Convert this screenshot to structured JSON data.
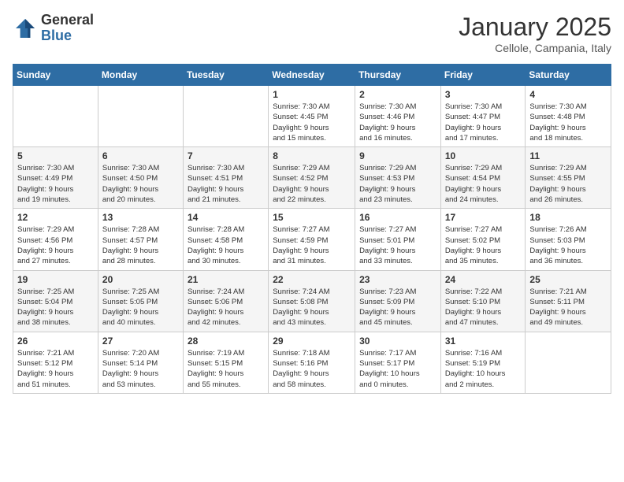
{
  "logo": {
    "general": "General",
    "blue": "Blue"
  },
  "title": "January 2025",
  "subtitle": "Cellole, Campania, Italy",
  "days": [
    "Sunday",
    "Monday",
    "Tuesday",
    "Wednesday",
    "Thursday",
    "Friday",
    "Saturday"
  ],
  "weeks": [
    [
      {
        "num": "",
        "info": ""
      },
      {
        "num": "",
        "info": ""
      },
      {
        "num": "",
        "info": ""
      },
      {
        "num": "1",
        "info": "Sunrise: 7:30 AM\nSunset: 4:45 PM\nDaylight: 9 hours\nand 15 minutes."
      },
      {
        "num": "2",
        "info": "Sunrise: 7:30 AM\nSunset: 4:46 PM\nDaylight: 9 hours\nand 16 minutes."
      },
      {
        "num": "3",
        "info": "Sunrise: 7:30 AM\nSunset: 4:47 PM\nDaylight: 9 hours\nand 17 minutes."
      },
      {
        "num": "4",
        "info": "Sunrise: 7:30 AM\nSunset: 4:48 PM\nDaylight: 9 hours\nand 18 minutes."
      }
    ],
    [
      {
        "num": "5",
        "info": "Sunrise: 7:30 AM\nSunset: 4:49 PM\nDaylight: 9 hours\nand 19 minutes."
      },
      {
        "num": "6",
        "info": "Sunrise: 7:30 AM\nSunset: 4:50 PM\nDaylight: 9 hours\nand 20 minutes."
      },
      {
        "num": "7",
        "info": "Sunrise: 7:30 AM\nSunset: 4:51 PM\nDaylight: 9 hours\nand 21 minutes."
      },
      {
        "num": "8",
        "info": "Sunrise: 7:29 AM\nSunset: 4:52 PM\nDaylight: 9 hours\nand 22 minutes."
      },
      {
        "num": "9",
        "info": "Sunrise: 7:29 AM\nSunset: 4:53 PM\nDaylight: 9 hours\nand 23 minutes."
      },
      {
        "num": "10",
        "info": "Sunrise: 7:29 AM\nSunset: 4:54 PM\nDaylight: 9 hours\nand 24 minutes."
      },
      {
        "num": "11",
        "info": "Sunrise: 7:29 AM\nSunset: 4:55 PM\nDaylight: 9 hours\nand 26 minutes."
      }
    ],
    [
      {
        "num": "12",
        "info": "Sunrise: 7:29 AM\nSunset: 4:56 PM\nDaylight: 9 hours\nand 27 minutes."
      },
      {
        "num": "13",
        "info": "Sunrise: 7:28 AM\nSunset: 4:57 PM\nDaylight: 9 hours\nand 28 minutes."
      },
      {
        "num": "14",
        "info": "Sunrise: 7:28 AM\nSunset: 4:58 PM\nDaylight: 9 hours\nand 30 minutes."
      },
      {
        "num": "15",
        "info": "Sunrise: 7:27 AM\nSunset: 4:59 PM\nDaylight: 9 hours\nand 31 minutes."
      },
      {
        "num": "16",
        "info": "Sunrise: 7:27 AM\nSunset: 5:01 PM\nDaylight: 9 hours\nand 33 minutes."
      },
      {
        "num": "17",
        "info": "Sunrise: 7:27 AM\nSunset: 5:02 PM\nDaylight: 9 hours\nand 35 minutes."
      },
      {
        "num": "18",
        "info": "Sunrise: 7:26 AM\nSunset: 5:03 PM\nDaylight: 9 hours\nand 36 minutes."
      }
    ],
    [
      {
        "num": "19",
        "info": "Sunrise: 7:25 AM\nSunset: 5:04 PM\nDaylight: 9 hours\nand 38 minutes."
      },
      {
        "num": "20",
        "info": "Sunrise: 7:25 AM\nSunset: 5:05 PM\nDaylight: 9 hours\nand 40 minutes."
      },
      {
        "num": "21",
        "info": "Sunrise: 7:24 AM\nSunset: 5:06 PM\nDaylight: 9 hours\nand 42 minutes."
      },
      {
        "num": "22",
        "info": "Sunrise: 7:24 AM\nSunset: 5:08 PM\nDaylight: 9 hours\nand 43 minutes."
      },
      {
        "num": "23",
        "info": "Sunrise: 7:23 AM\nSunset: 5:09 PM\nDaylight: 9 hours\nand 45 minutes."
      },
      {
        "num": "24",
        "info": "Sunrise: 7:22 AM\nSunset: 5:10 PM\nDaylight: 9 hours\nand 47 minutes."
      },
      {
        "num": "25",
        "info": "Sunrise: 7:21 AM\nSunset: 5:11 PM\nDaylight: 9 hours\nand 49 minutes."
      }
    ],
    [
      {
        "num": "26",
        "info": "Sunrise: 7:21 AM\nSunset: 5:12 PM\nDaylight: 9 hours\nand 51 minutes."
      },
      {
        "num": "27",
        "info": "Sunrise: 7:20 AM\nSunset: 5:14 PM\nDaylight: 9 hours\nand 53 minutes."
      },
      {
        "num": "28",
        "info": "Sunrise: 7:19 AM\nSunset: 5:15 PM\nDaylight: 9 hours\nand 55 minutes."
      },
      {
        "num": "29",
        "info": "Sunrise: 7:18 AM\nSunset: 5:16 PM\nDaylight: 9 hours\nand 58 minutes."
      },
      {
        "num": "30",
        "info": "Sunrise: 7:17 AM\nSunset: 5:17 PM\nDaylight: 10 hours\nand 0 minutes."
      },
      {
        "num": "31",
        "info": "Sunrise: 7:16 AM\nSunset: 5:19 PM\nDaylight: 10 hours\nand 2 minutes."
      },
      {
        "num": "",
        "info": ""
      }
    ]
  ]
}
